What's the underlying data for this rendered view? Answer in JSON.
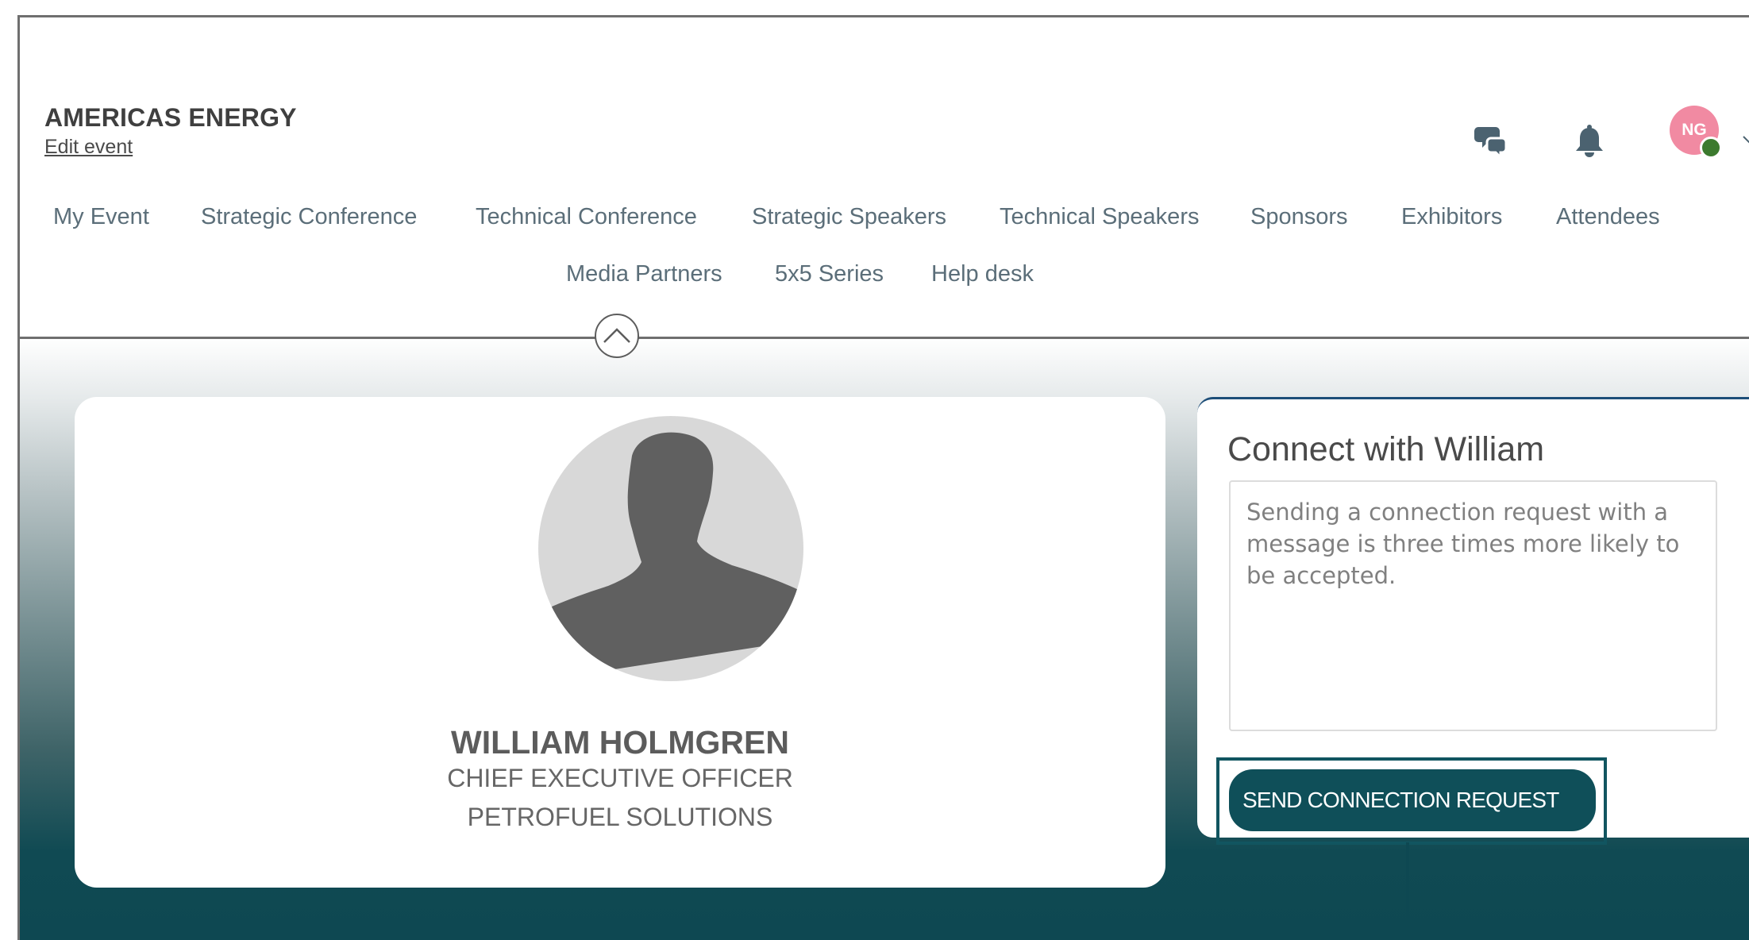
{
  "header": {
    "event_title": "AMERICAS ENERGY",
    "edit_link": "Edit event",
    "avatar_initials": "NG",
    "presence_color": "#3c7a2e",
    "icons": [
      "chat-icon",
      "bell-icon",
      "chevron-down-icon",
      "chevron-up-icon"
    ]
  },
  "nav": {
    "row1": [
      "My Event",
      "Strategic Conference",
      "Technical Conference",
      "Strategic Speakers",
      "Technical Speakers",
      "Sponsors",
      "Exhibitors",
      "Attendees"
    ],
    "row2": [
      "Media Partners",
      "5x5 Series",
      "Help desk"
    ]
  },
  "profile": {
    "name": "WILLIAM HOLMGREN",
    "title": "CHIEF EXECUTIVE OFFICER",
    "company": "PETROFUEL SOLUTIONS"
  },
  "connect": {
    "heading": "Connect with William",
    "placeholder": "Sending a connection request with a message is three times more likely to be accepted.",
    "button_label": "SEND CONNECTION REQUEST"
  },
  "colors": {
    "brand_teal": "#0f4f59",
    "nav_text": "#5b6e79",
    "avatar_pink": "#f18aa2"
  }
}
